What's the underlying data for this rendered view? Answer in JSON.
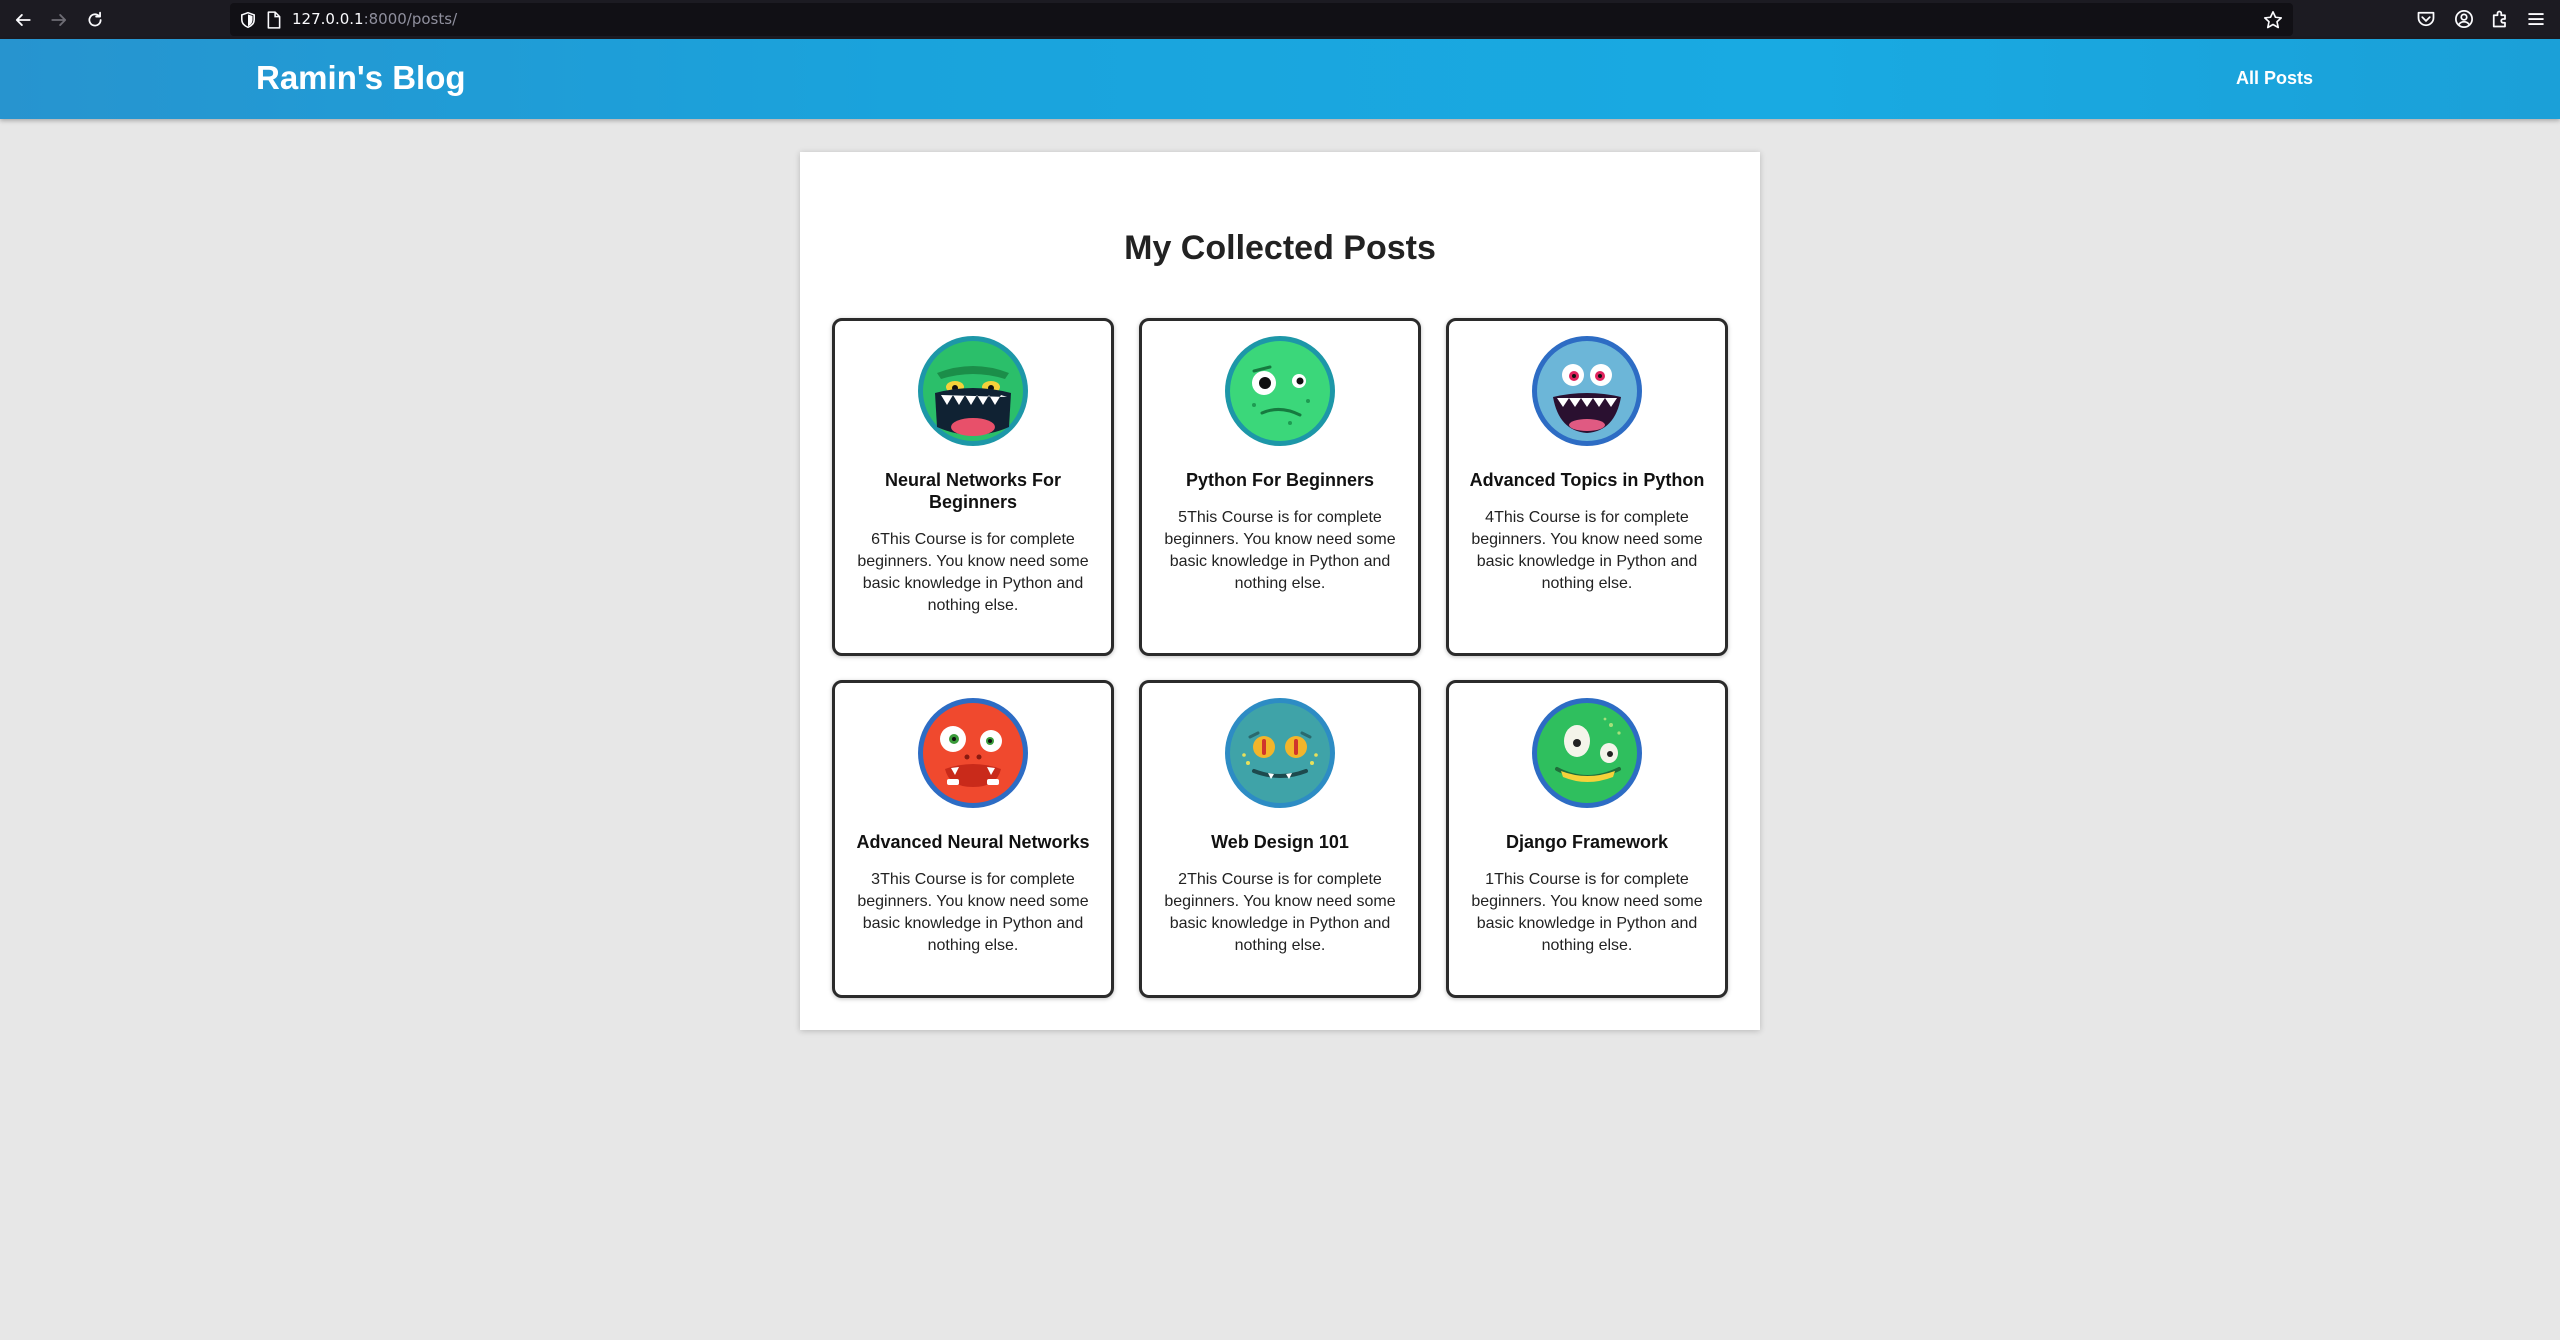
{
  "browser": {
    "url_host": "127.0.0.1",
    "url_path": ":8000/posts/"
  },
  "header": {
    "site_title": "Ramin's Blog",
    "nav_all_posts": "All Posts",
    "gradient_colors": [
      "#2794cf",
      "#19aae2"
    ]
  },
  "main": {
    "title": "My Collected Posts",
    "posts": [
      {
        "title": "Neural Networks For Beginners",
        "excerpt": "6This Course is for complete beginners. You know need some basic knowledge in Python and nothing else.",
        "avatar": "green-monster-avatar"
      },
      {
        "title": "Python For Beginners",
        "excerpt": "5This Course is for complete beginners. You know need some basic knowledge in Python and nothing else.",
        "avatar": "green-blob-monster-avatar"
      },
      {
        "title": "Advanced Topics in Python",
        "excerpt": "4This Course is for complete beginners. You know need some basic knowledge in Python and nothing else.",
        "avatar": "blue-monster-avatar"
      },
      {
        "title": "Advanced Neural Networks",
        "excerpt": "3This Course is for complete beginners. You know need some basic knowledge in Python and nothing else.",
        "avatar": "red-monster-avatar"
      },
      {
        "title": "Web Design 101",
        "excerpt": "2This Course is for complete beginners. You know need some basic knowledge in Python and nothing else.",
        "avatar": "teal-lizard-avatar"
      },
      {
        "title": "Django Framework",
        "excerpt": "1This Course is for complete beginners. You know need some basic knowledge in Python and nothing else.",
        "avatar": "green-cyclops-avatar"
      }
    ]
  }
}
